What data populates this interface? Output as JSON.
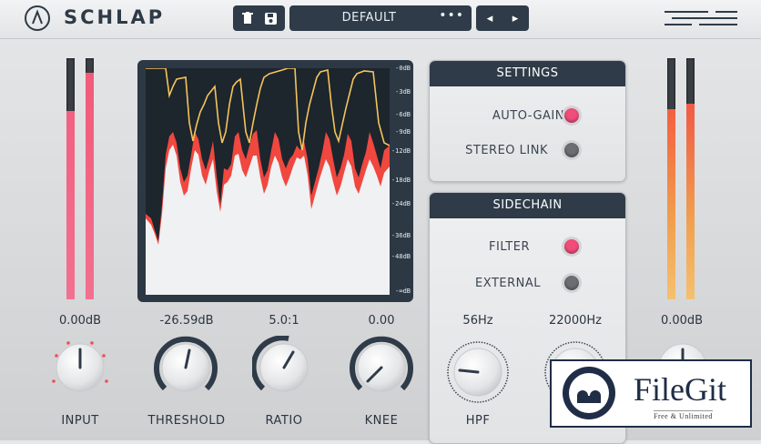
{
  "app": {
    "logo_text": "SCHLAP"
  },
  "toolbar": {
    "preset_name": "DEFAULT",
    "preset_menu": "•••",
    "prev": "◂",
    "next": "▸"
  },
  "meters": {
    "input": {
      "value_label": "0.00dB",
      "left_level": 0.78,
      "right_level": 0.94
    },
    "output": {
      "value_label": "0.00dB",
      "left_level": 0.79,
      "right_level": 0.81
    }
  },
  "graph": {
    "db_scale": [
      "-0dB",
      "-3dB",
      "-6dB",
      "-9dB",
      "-12dB",
      "-18dB",
      "-24dB",
      "-36dB",
      "-48dB",
      "-∞dB"
    ]
  },
  "settings": {
    "title": "SETTINGS",
    "auto_gain": {
      "label": "AUTO-GAIN",
      "on": true
    },
    "stereo_link": {
      "label": "STEREO LINK",
      "on": false
    }
  },
  "sidechain": {
    "title": "SIDECHAIN",
    "filter": {
      "label": "FILTER",
      "on": true
    },
    "external": {
      "label": "EXTERNAL",
      "on": false
    },
    "hpf": {
      "label": "HPF",
      "value": "56Hz"
    },
    "lpf": {
      "value": "22000Hz"
    }
  },
  "knobs": {
    "input": {
      "label": "INPUT",
      "value": "0.00dB"
    },
    "threshold": {
      "label": "THRESHOLD",
      "value": "-26.59dB"
    },
    "ratio": {
      "label": "RATIO",
      "value": "5.0:1"
    },
    "knee": {
      "label": "KNEE",
      "value": "0.00"
    }
  },
  "watermark": {
    "name": "FileGit",
    "tagline": "Free & Unlimited"
  },
  "colors": {
    "accent": "#f04d7a",
    "off": "#6b6e72",
    "panel_dark": "#2f3b48"
  }
}
